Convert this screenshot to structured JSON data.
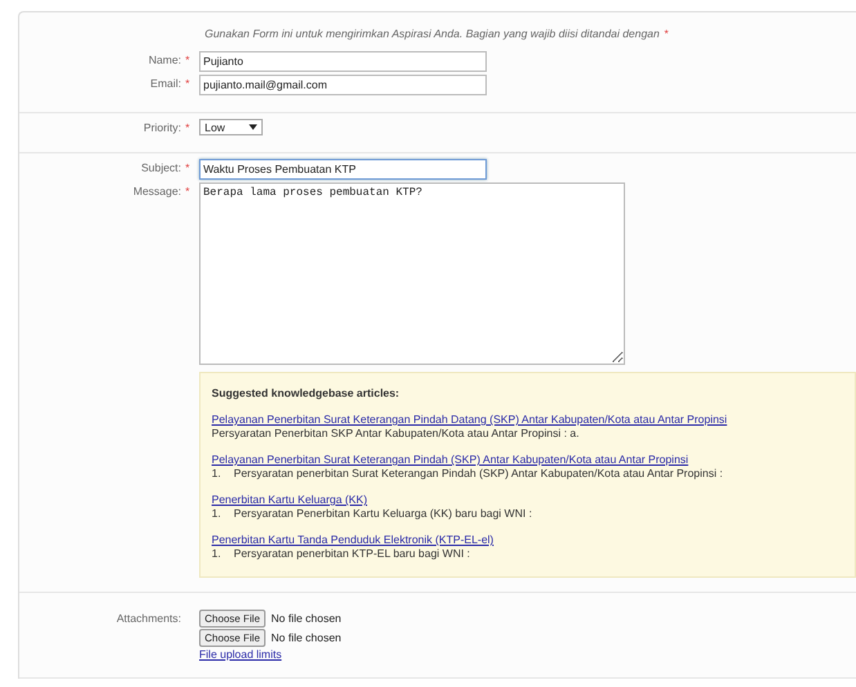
{
  "intro": {
    "text": "Gunakan Form ini untuk mengirimkan Aspirasi Anda. Bagian yang wajib diisi ditandai dengan",
    "mark": "*"
  },
  "sections": [
    {
      "fields": [
        {
          "kind": "text",
          "label": "Name:",
          "required": true,
          "value": "Pujianto",
          "focused": false
        },
        {
          "kind": "text",
          "label": "Email:",
          "required": true,
          "value": "pujianto.mail@gmail.com",
          "focused": false
        }
      ]
    },
    {
      "fields": [
        {
          "kind": "select",
          "label": "Priority:",
          "required": true,
          "value": "Low",
          "focused": false
        }
      ]
    },
    {
      "fields": [
        {
          "kind": "text",
          "label": "Subject:",
          "required": true,
          "value": "Waktu Proses Pembuatan KTP",
          "focused": true
        },
        {
          "kind": "textarea",
          "label": "Message:",
          "required": true,
          "value": "Berapa lama proses pembuatan KTP?",
          "focused": false
        }
      ],
      "knowledgebase": {
        "title": "Suggested knowledgebase articles:",
        "articles": [
          {
            "title": "Pelayanan Penerbitan Surat Keterangan Pindah Datang (SKP) Antar Kabupaten/Kota atau Antar Propinsi",
            "summary": "Persyaratan Penerbitan SKP Antar Kabupaten/Kota atau Antar Propinsi : a."
          },
          {
            "title": "Pelayanan Penerbitan Surat Keterangan Pindah (SKP) Antar Kabupaten/Kota atau Antar Propinsi",
            "number": "1.",
            "summary": "Persyaratan penerbitan Surat Keterangan Pindah (SKP) Antar Kabupaten/Kota atau Antar Propinsi :"
          },
          {
            "title": "Penerbitan Kartu Keluarga (KK)",
            "number": "1.",
            "summary": "Persyaratan Penerbitan Kartu Keluarga (KK) baru bagi WNI :"
          },
          {
            "title": "Penerbitan Kartu Tanda Penduduk Elektronik (KTP-EL-el)",
            "number": "1.",
            "summary": "Persyaratan penerbitan KTP-EL baru bagi WNI :"
          }
        ]
      }
    },
    {
      "attachments": {
        "label": "Attachments:",
        "files": [
          {
            "button": "Choose File",
            "status": "No file chosen"
          },
          {
            "button": "Choose File",
            "status": "No file chosen"
          }
        ],
        "link": "File upload limits"
      }
    }
  ]
}
